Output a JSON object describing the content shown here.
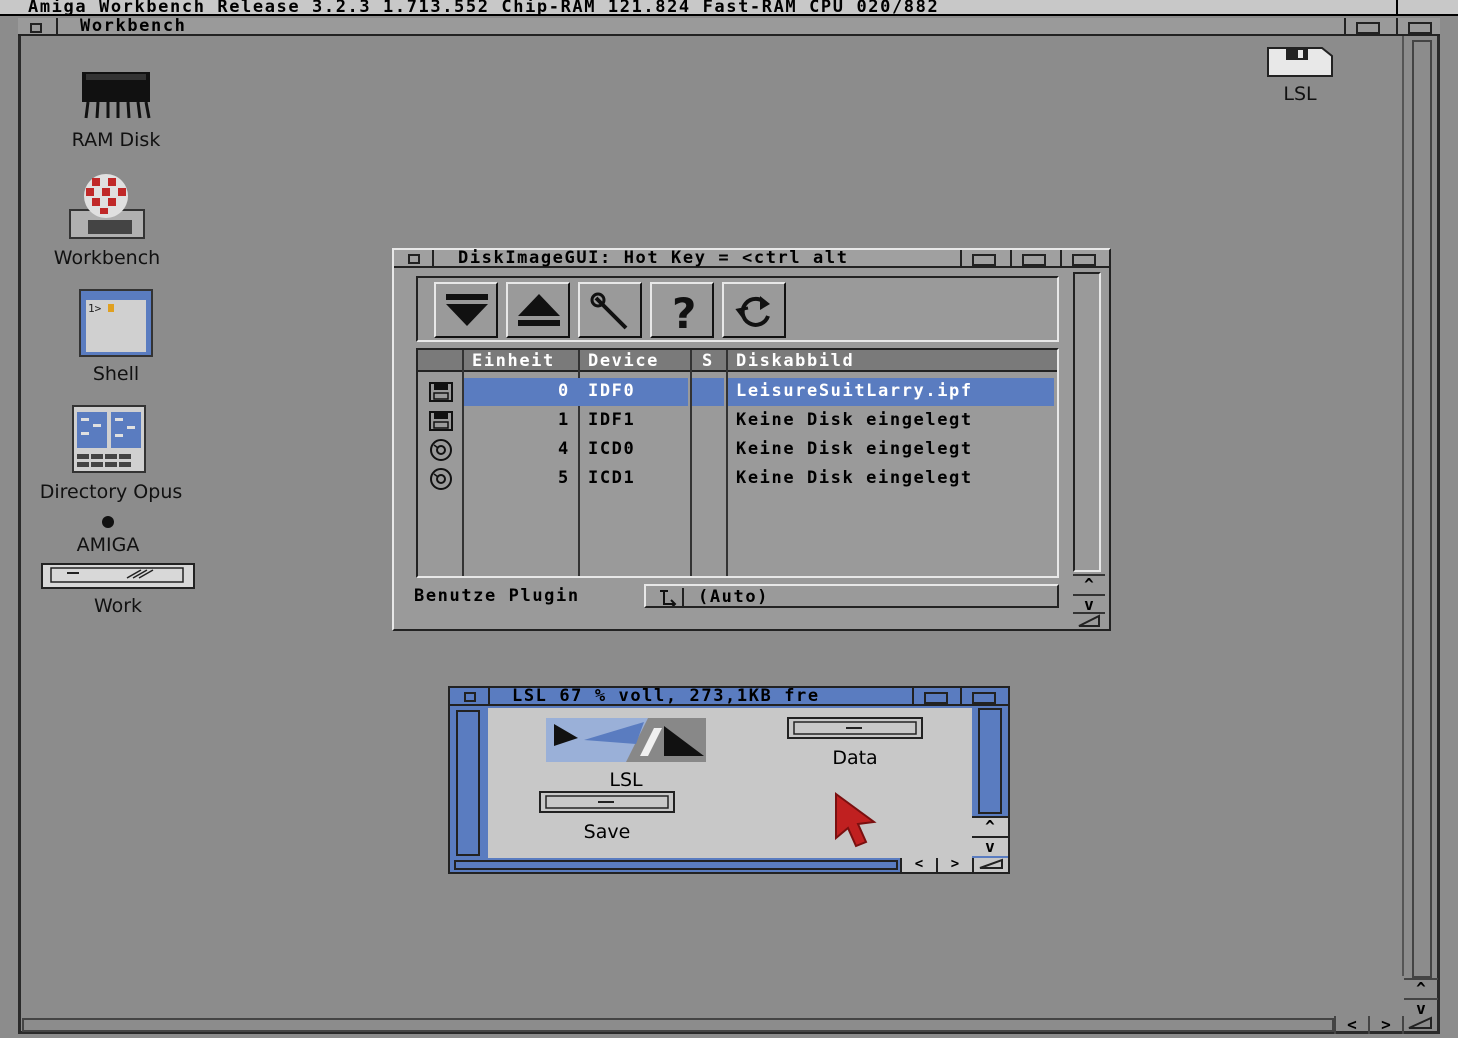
{
  "screen": {
    "title": "Amiga Workbench Release 3.2.3  1.713.552 Chip-RAM  121.824 Fast-RAM  CPU 020/882"
  },
  "workbench_window": {
    "title": "Workbench"
  },
  "desktop_icons": {
    "ram_disk": "RAM Disk",
    "workbench": "Workbench",
    "shell": "Shell",
    "dopus": "Directory Opus",
    "amiga": "AMIGA",
    "work": "Work",
    "lsl_disk": "LSL"
  },
  "diskimagegui": {
    "title": "DiskImageGUI: Hot Key = <ctrl alt",
    "toolbar": [
      "insert-icon",
      "eject-icon",
      "settings-icon",
      "help-icon",
      "refresh-icon"
    ],
    "columns": [
      "Einheit",
      "Device",
      "S",
      "Diskabbild"
    ],
    "rows": [
      {
        "unit": "0",
        "device": "IDF0",
        "s": "",
        "image": "LeisureSuitLarry.ipf",
        "type": "floppy",
        "selected": true
      },
      {
        "unit": "1",
        "device": "IDF1",
        "s": "",
        "image": "Keine Disk eingelegt",
        "type": "floppy",
        "selected": false
      },
      {
        "unit": "4",
        "device": "ICD0",
        "s": "",
        "image": "Keine Disk eingelegt",
        "type": "cd",
        "selected": false
      },
      {
        "unit": "5",
        "device": "ICD1",
        "s": "",
        "image": "Keine Disk eingelegt",
        "type": "cd",
        "selected": false
      }
    ],
    "plugin_label": "Benutze Plugin",
    "plugin_value": "(Auto)"
  },
  "lsl_window": {
    "title": "LSL  67 % voll, 273,1KB fre",
    "icons": {
      "lsl": "LSL",
      "data": "Data",
      "save": "Save"
    }
  },
  "scroll_arrows": {
    "up": "^",
    "down": "v",
    "left": "<",
    "right": ">"
  },
  "colors": {
    "background": "#8c8c8c",
    "selection": "#5a7cc0",
    "window_light": "#c8c8c8",
    "pointer": "#c02020"
  }
}
